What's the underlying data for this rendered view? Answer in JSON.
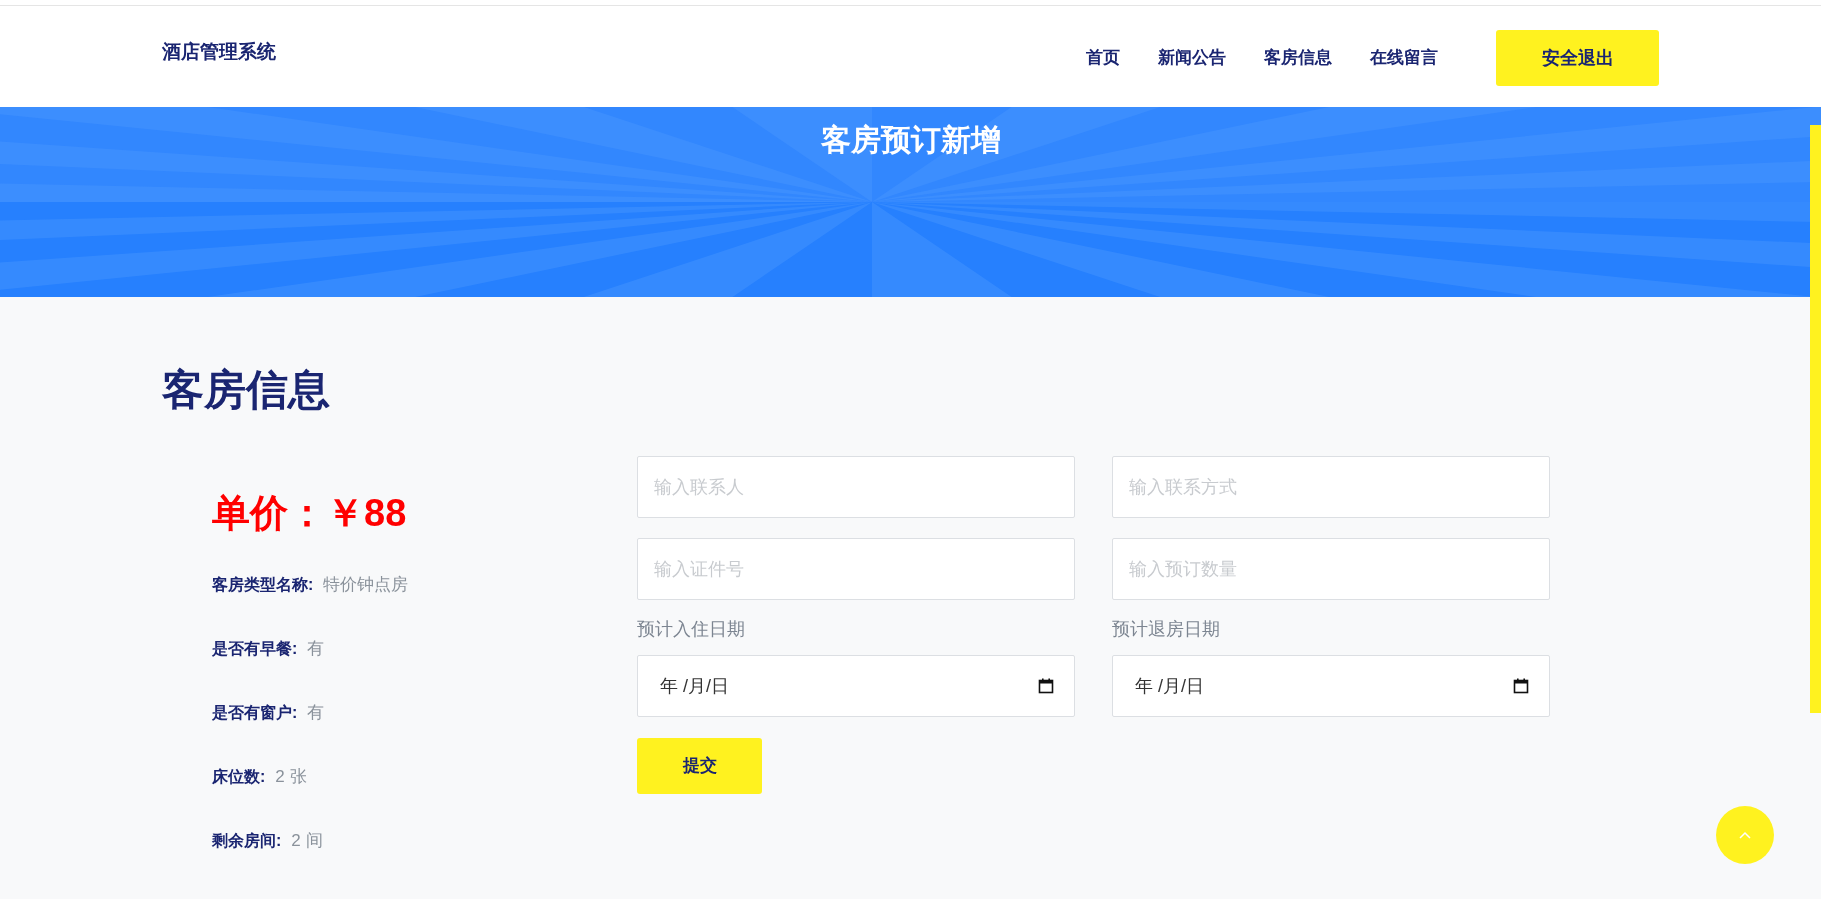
{
  "header": {
    "logo": "酒店管理系统",
    "nav": [
      {
        "label": "首页"
      },
      {
        "label": "新闻公告"
      },
      {
        "label": "客房信息"
      },
      {
        "label": "在线留言"
      }
    ],
    "logout": "安全退出"
  },
  "banner": {
    "title": "客房预订新增"
  },
  "section": {
    "heading": "客房信息"
  },
  "room": {
    "price": "单价：￥88",
    "details": [
      {
        "label": "客房类型名称:",
        "value": "特价钟点房"
      },
      {
        "label": "是否有早餐:",
        "value": "有"
      },
      {
        "label": "是否有窗户:",
        "value": "有"
      },
      {
        "label": "床位数:",
        "value": "2 张"
      },
      {
        "label": "剩余房间:",
        "value": "2 间"
      }
    ]
  },
  "form": {
    "fields": [
      {
        "placeholder": "输入联系人"
      },
      {
        "placeholder": "输入联系方式"
      },
      {
        "placeholder": "输入证件号"
      },
      {
        "placeholder": "输入预订数量"
      }
    ],
    "dates": [
      {
        "label": "预计入住日期",
        "value": "年 /月/日"
      },
      {
        "label": "预计退房日期",
        "value": "年 /月/日"
      }
    ],
    "submit": "提交"
  }
}
